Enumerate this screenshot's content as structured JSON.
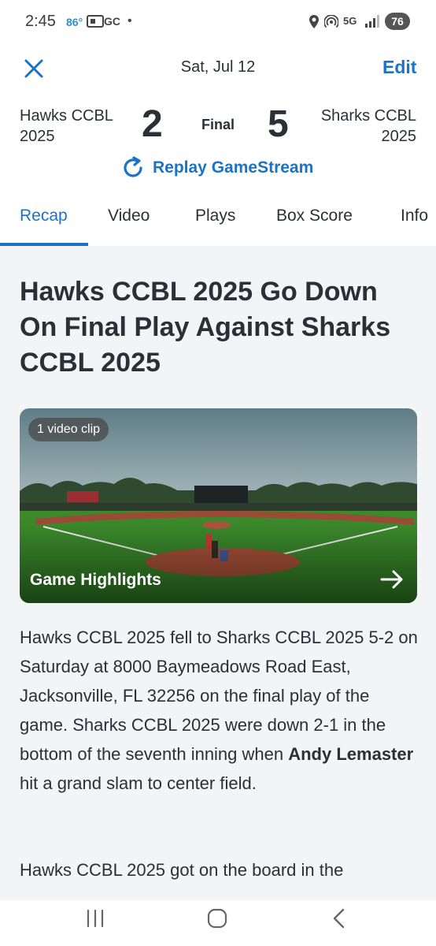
{
  "status_bar": {
    "time": "2:45",
    "temperature": "86°",
    "app_label": "GC",
    "dot": "•",
    "network": "5G",
    "battery": "76"
  },
  "header": {
    "date": "Sat, Jul 12",
    "edit_label": "Edit"
  },
  "score": {
    "away_team_line1": "Hawks CCBL",
    "away_team_line2": "2025",
    "away_score": "2",
    "status": "Final",
    "home_score": "5",
    "home_team_line1": "Sharks CCBL",
    "home_team_line2": "2025"
  },
  "replay_label": "Replay GameStream",
  "tabs": [
    {
      "label": "Recap",
      "active": true
    },
    {
      "label": "Video",
      "active": false
    },
    {
      "label": "Plays",
      "active": false
    },
    {
      "label": "Box Score",
      "active": false
    },
    {
      "label": "Info",
      "active": false
    }
  ],
  "headline": "Hawks CCBL 2025 Go Down On Final Play Against Sharks CCBL 2025",
  "video": {
    "badge": "1 video clip",
    "title": "Game Highlights"
  },
  "recap": {
    "text_before": "Hawks CCBL 2025 fell to Sharks CCBL 2025 5-2 on Saturday at 8000 Baymeadows Road East, Jacksonville, FL 32256 on the final play of the game. Sharks CCBL 2025 were down 2-1 in the bottom of the seventh inning when ",
    "player": "Andy Lemaster",
    "text_after": " hit a grand slam to center field.",
    "paragraph2": "Hawks CCBL 2025 got on the board in the"
  },
  "colors": {
    "accent": "#1a73c8",
    "text": "#2b2f36",
    "content_bg": "#f3f4f6"
  }
}
